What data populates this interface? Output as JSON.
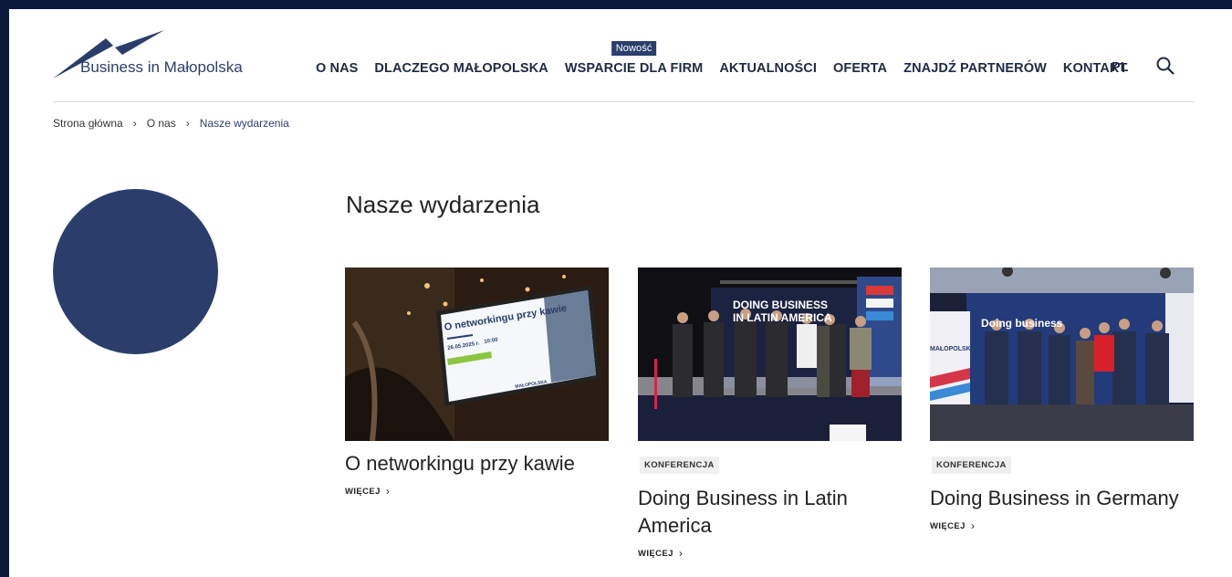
{
  "header": {
    "logo_text": "Business in Małopolska",
    "nav": [
      {
        "label": "O NAS"
      },
      {
        "label": "DLACZEGO MAŁOPOLSKA"
      },
      {
        "label": "WSPARCIE DLA FIRM",
        "badge": "Nowość"
      },
      {
        "label": "AKTUALNOŚCI"
      },
      {
        "label": "OFERTA"
      },
      {
        "label": "ZNAJDŹ PARTNERÓW"
      },
      {
        "label": "KONTAKT"
      }
    ],
    "lang": "PL"
  },
  "breadcrumb": {
    "items": [
      "Strona główna",
      "O nas",
      "Nasze wydarzenia"
    ]
  },
  "page_title": "Nasze wydarzenia",
  "cards": [
    {
      "title": "O networkingu przy kawie",
      "tag": "",
      "more": "WIĘCEJ",
      "image": {
        "screen_title": "O networkingu przy kawie",
        "screen_date": "26.05.2025 r.",
        "screen_time": "10:00",
        "screen_brand": "MAŁOPOLSKA"
      }
    },
    {
      "title": "Doing Business in Latin America",
      "tag": "KONFERENCJA",
      "more": "WIĘCEJ",
      "image": {
        "screen_title_1": "DOING BUSINESS",
        "screen_title_2": "IN LATIN AMERICA"
      }
    },
    {
      "title": "Doing Business in Germany",
      "tag": "KONFERENCJA",
      "more": "WIĘCEJ",
      "image": {
        "screen_title": "Doing business",
        "banner": "MAŁOPOLSKA"
      }
    }
  ],
  "colors": {
    "brand": "#2b3e6b",
    "outer_background": "#0b1a3a"
  }
}
